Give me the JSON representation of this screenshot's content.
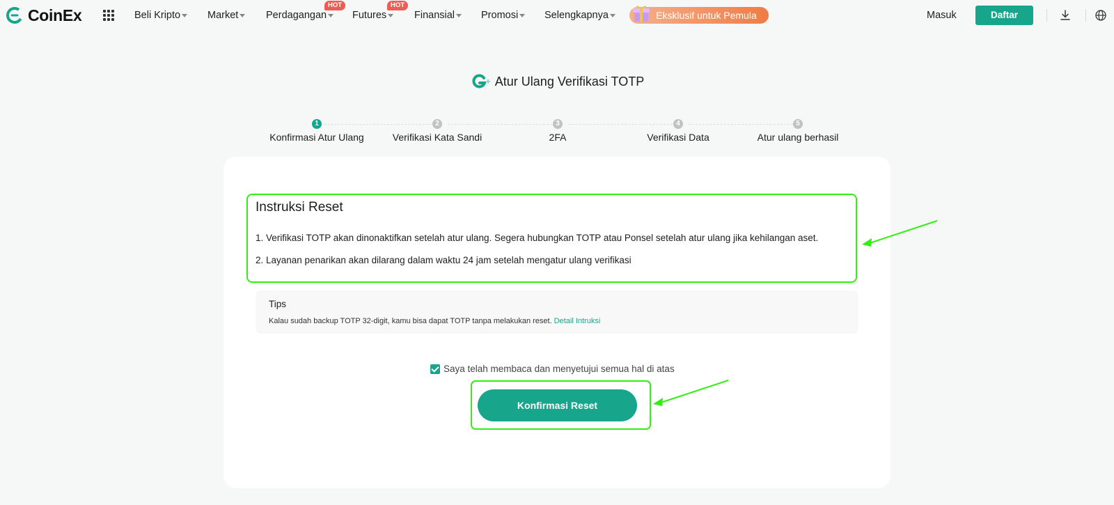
{
  "brand": {
    "name": "CoinEx",
    "accent": "#17a58c",
    "highlight": "#33ee11"
  },
  "nav": {
    "items": [
      {
        "label": "Beli Kripto",
        "hot": false
      },
      {
        "label": "Market",
        "hot": false
      },
      {
        "label": "Perdagangan",
        "hot": true
      },
      {
        "label": "Futures",
        "hot": true
      },
      {
        "label": "Finansial",
        "hot": false
      },
      {
        "label": "Promosi",
        "hot": false
      },
      {
        "label": "Selengkapnya",
        "hot": false
      }
    ],
    "hot_badge": "HOT",
    "promo": "Eksklusif untuk Pemula",
    "login": "Masuk",
    "register": "Daftar",
    "icons": [
      "apps-grid-icon",
      "download-icon",
      "globe-icon"
    ]
  },
  "page": {
    "title": "Atur Ulang Verifikasi TOTP",
    "steps": [
      {
        "num": "1",
        "label": "Konfirmasi Atur Ulang",
        "active": true
      },
      {
        "num": "2",
        "label": "Verifikasi Kata Sandi",
        "active": false
      },
      {
        "num": "3",
        "label": "2FA",
        "active": false
      },
      {
        "num": "4",
        "label": "Verifikasi Data",
        "active": false
      },
      {
        "num": "5",
        "label": "Atur ulang berhasil",
        "active": false
      }
    ]
  },
  "instructions": {
    "title": "Instruksi Reset",
    "items": [
      "1. Verifikasi TOTP akan dinonaktifkan setelah atur ulang. Segera hubungkan TOTP atau Ponsel setelah atur ulang jika kehilangan aset.",
      "2. Layanan penarikan akan dilarang dalam waktu 24 jam setelah mengatur ulang verifikasi"
    ]
  },
  "tips": {
    "title": "Tips",
    "text": "Kalau sudah backup TOTP 32-digit, kamu bisa dapat TOTP tanpa melakukan reset.",
    "link": "Detail Intruksi"
  },
  "agreement": {
    "label": "Saya telah membaca dan menyetujui semua hal di atas",
    "checked": true
  },
  "confirm_button": "Konfirmasi Reset"
}
